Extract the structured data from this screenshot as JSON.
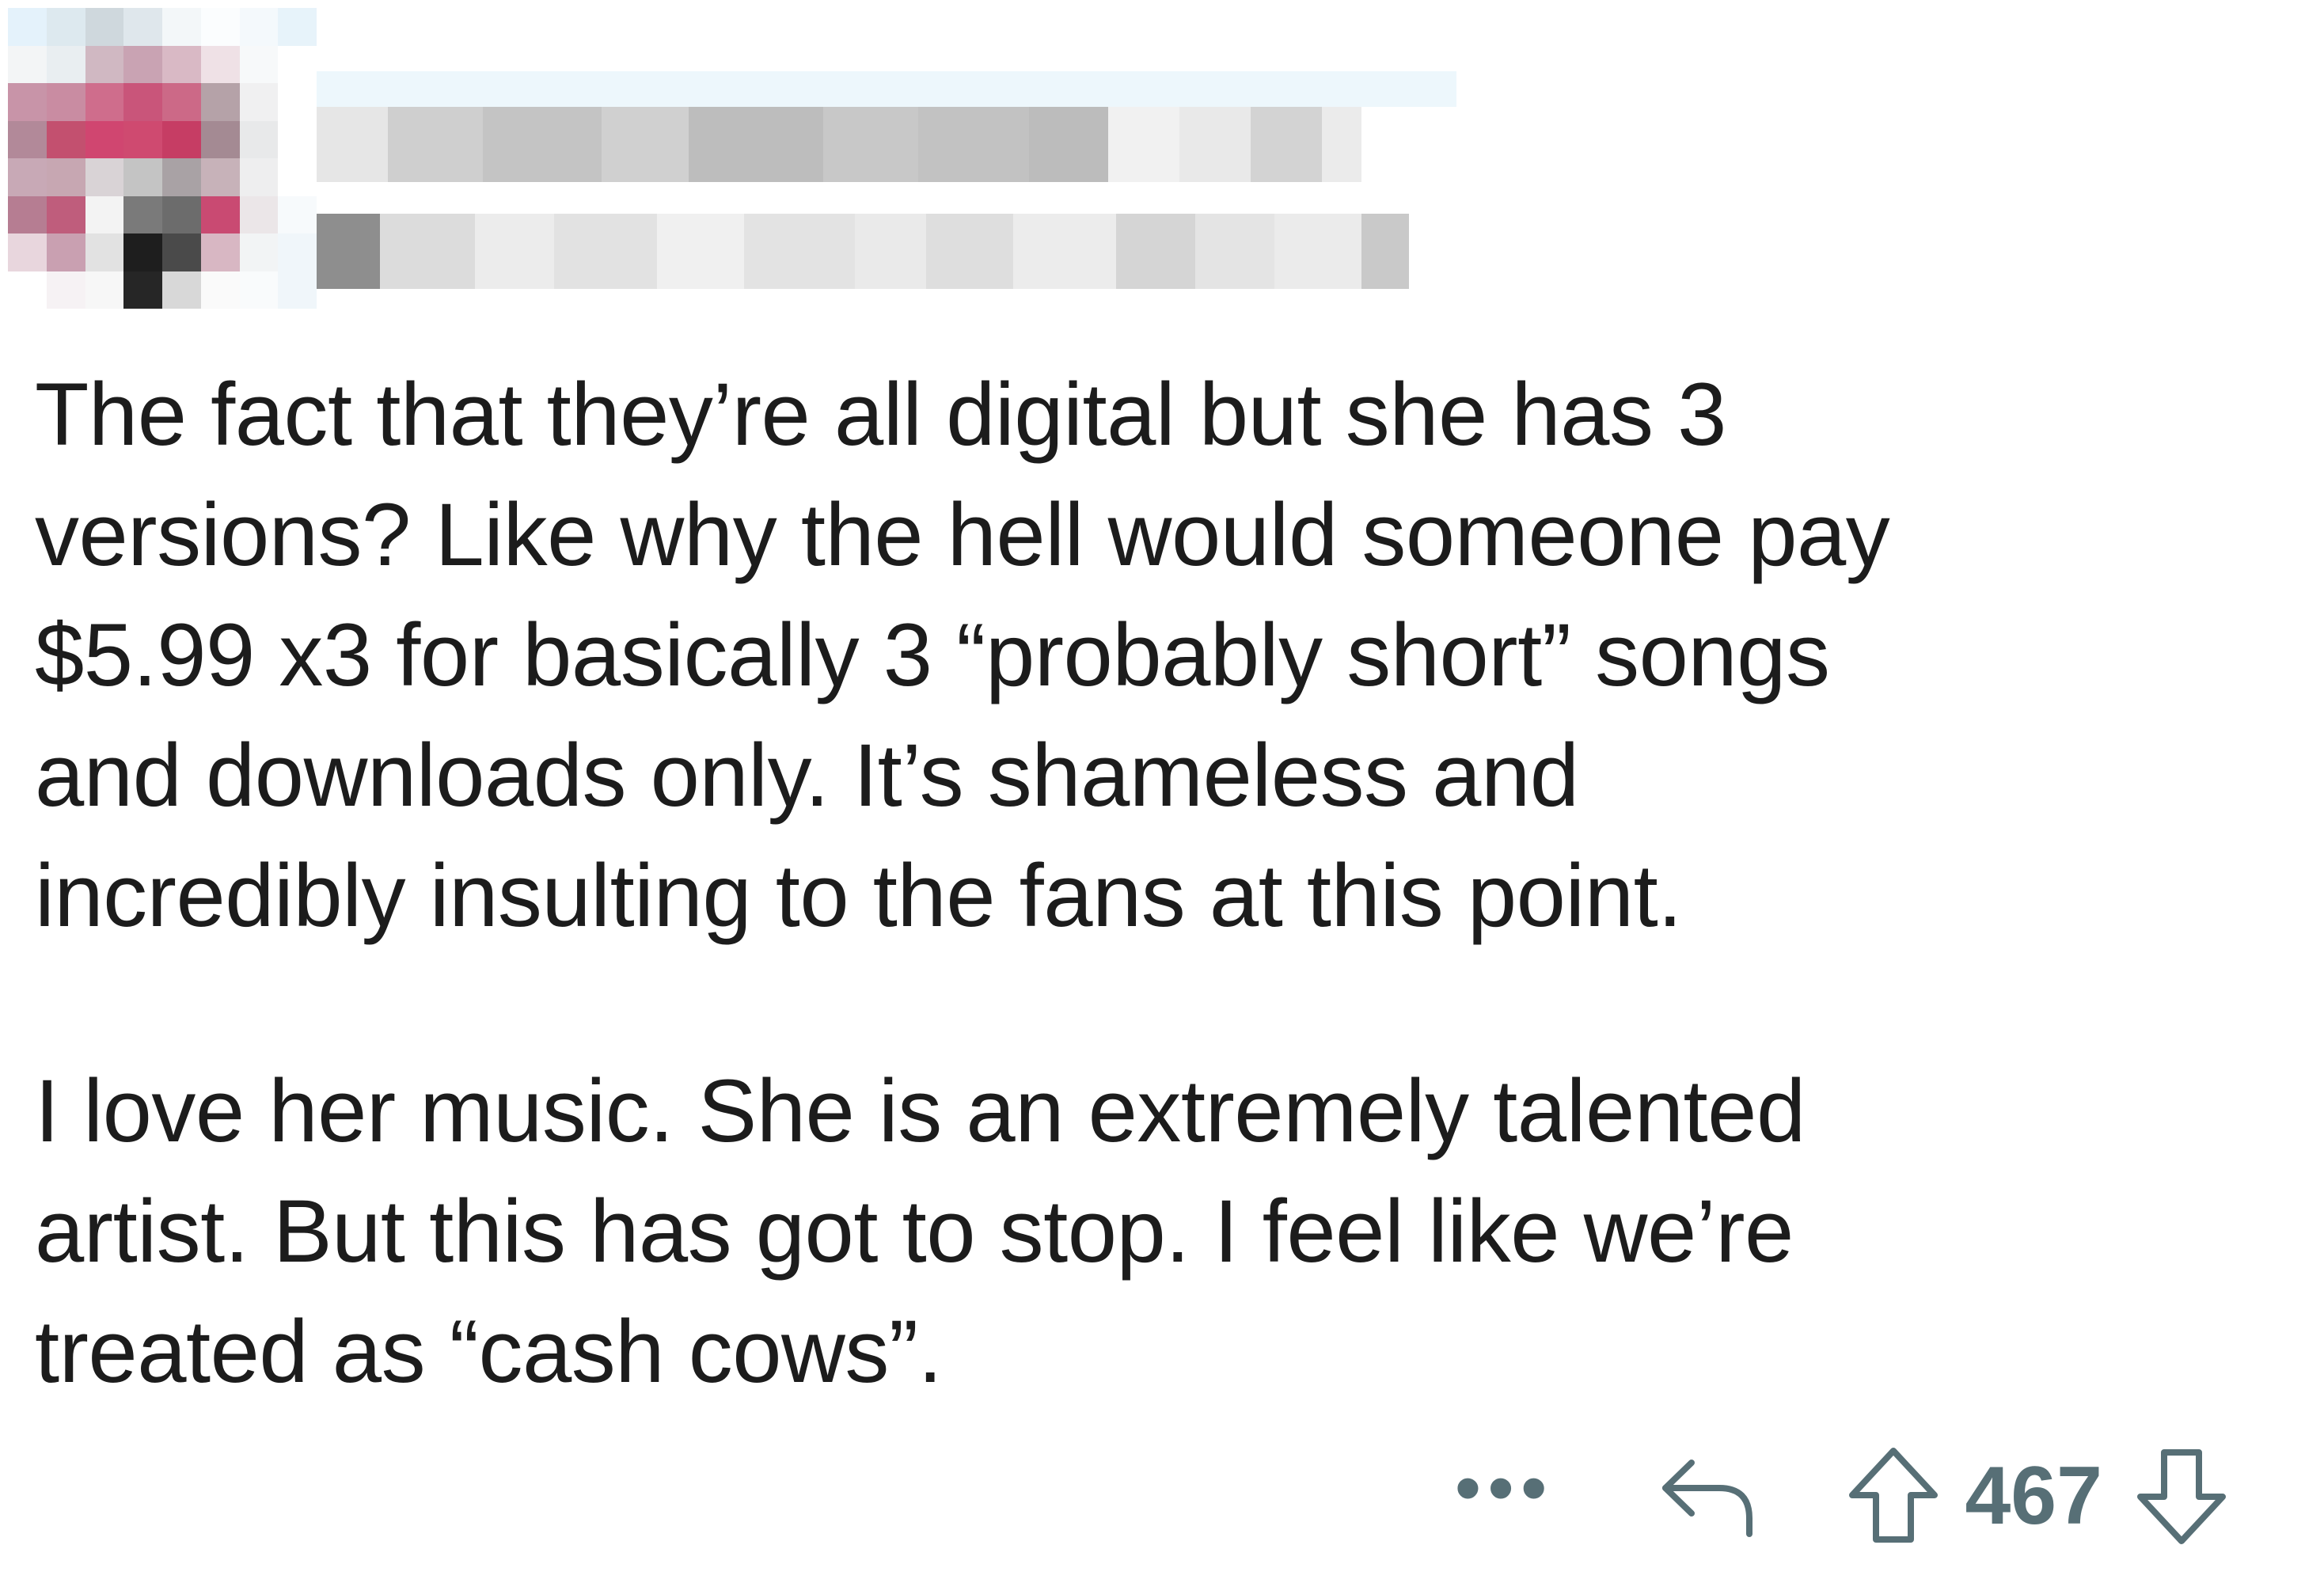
{
  "comment": {
    "paragraphs": [
      "The fact that they’re all digital but she has 3\nversions? Like why the hell would someone pay\n$5.99 x3 for basically 3 “probably short” songs\nand downloads only. It’s shameless and\nincredibly insulting to the fans at this point.",
      "I love her music. She is an extremely talented\nartist. But this has got to stop. I feel like we’re\ntreated as “cash cows”."
    ]
  },
  "actions": {
    "more_icon": "more-dots-icon",
    "reply_icon": "reply-arrow-icon",
    "upvote_icon": "upvote-arrow-icon",
    "vote_count": "467",
    "downvote_icon": "downvote-arrow-icon"
  },
  "colors": {
    "text": "#1c1c1c",
    "action_gray": "#576f76"
  }
}
